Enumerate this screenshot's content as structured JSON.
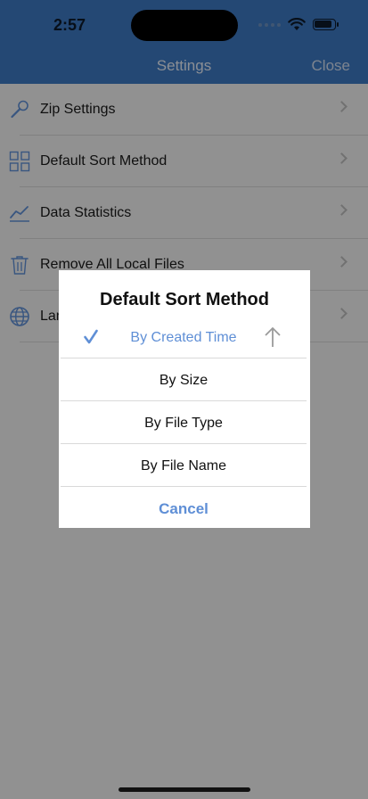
{
  "status_bar": {
    "time": "2:57"
  },
  "nav": {
    "title": "Settings",
    "close_label": "Close"
  },
  "settings_list": [
    {
      "label": "Zip Settings",
      "icon": "wrench-icon"
    },
    {
      "label": "Default Sort Method",
      "icon": "grid-icon"
    },
    {
      "label": "Data Statistics",
      "icon": "chart-line-icon"
    },
    {
      "label": "Remove All Local Files",
      "icon": "trash-icon"
    },
    {
      "label": "Language",
      "icon": "globe-icon"
    }
  ],
  "dialog": {
    "title": "Default Sort Method",
    "options": [
      {
        "label": "By Created Time",
        "selected": true
      },
      {
        "label": "By Size",
        "selected": false
      },
      {
        "label": "By File Type",
        "selected": false
      },
      {
        "label": "By File Name",
        "selected": false
      }
    ],
    "cancel_label": "Cancel"
  },
  "colors": {
    "accent": "#3d78c2",
    "link": "#5f8fd6"
  }
}
